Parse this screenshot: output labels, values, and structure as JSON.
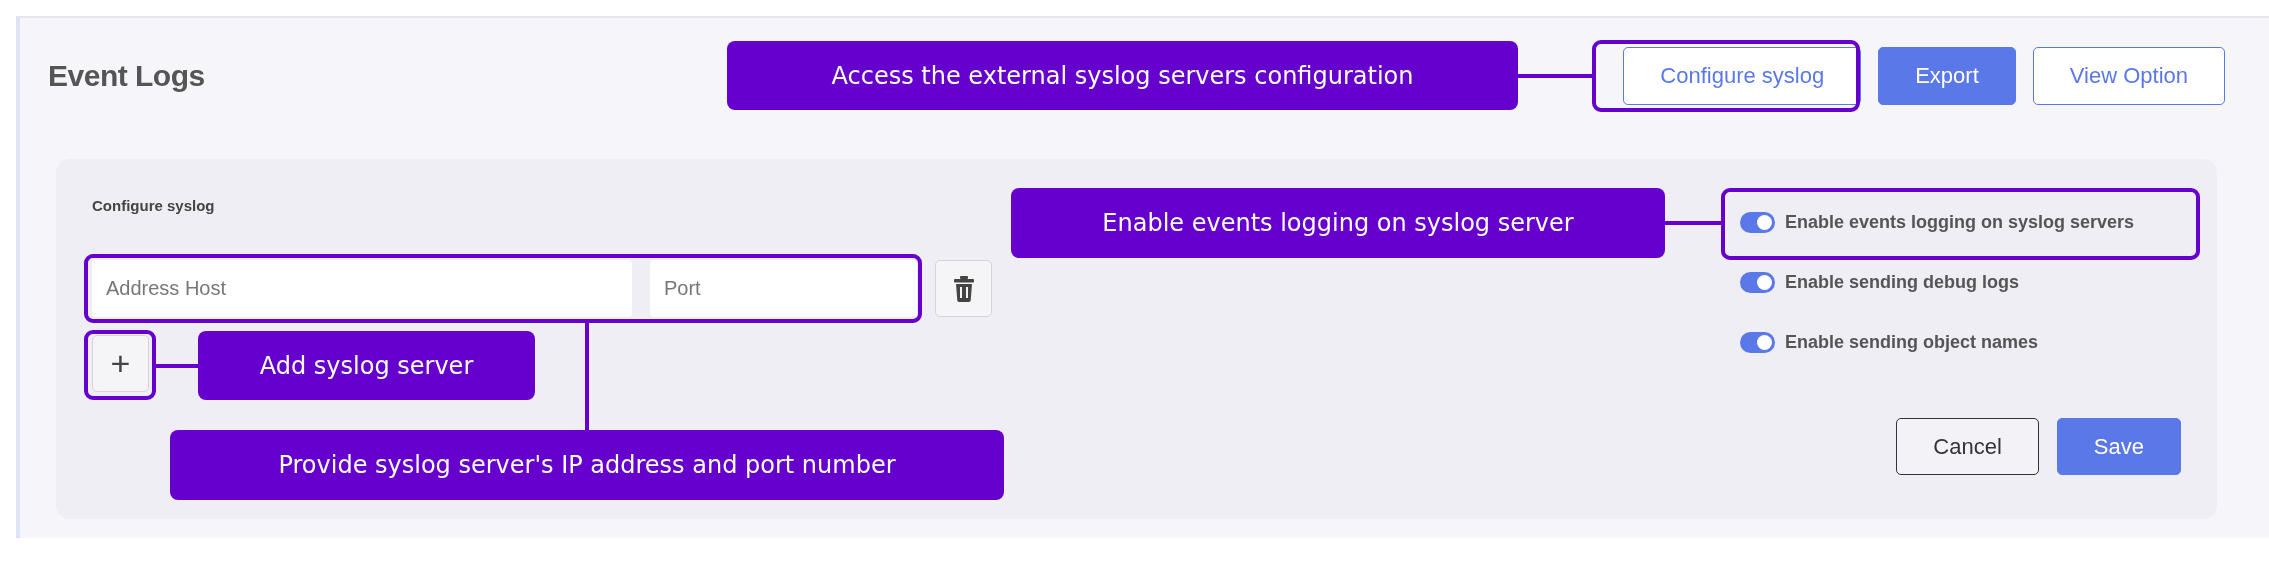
{
  "page": {
    "title": "Event Logs",
    "buttons": [
      {
        "label": "Configure syslog",
        "kind": "outline"
      },
      {
        "label": "Export",
        "kind": "primary"
      },
      {
        "label": "View Option",
        "kind": "outline"
      }
    ]
  },
  "syslog_card": {
    "title": "Configure syslog",
    "servers": [
      {
        "host": {
          "placeholder": "Address Host"
        },
        "port": {
          "placeholder": "Port"
        }
      }
    ],
    "add_button": "+",
    "options": [
      {
        "label": "Enable events logging on syslog servers",
        "on": true
      },
      {
        "label": "Enable sending debug logs",
        "on": true
      },
      {
        "label": "Enable sending object names",
        "on": true
      }
    ],
    "buttons": [
      {
        "label": "Cancel",
        "kind": "secondary"
      },
      {
        "label": "Save",
        "kind": "primary"
      }
    ]
  },
  "annotations": [
    {
      "text": "Access the external syslog servers configuration"
    },
    {
      "text": "Enable events logging on syslog server"
    },
    {
      "text": "Add syslog server"
    },
    {
      "text": "Provide syslog server's IP address and port number"
    }
  ]
}
